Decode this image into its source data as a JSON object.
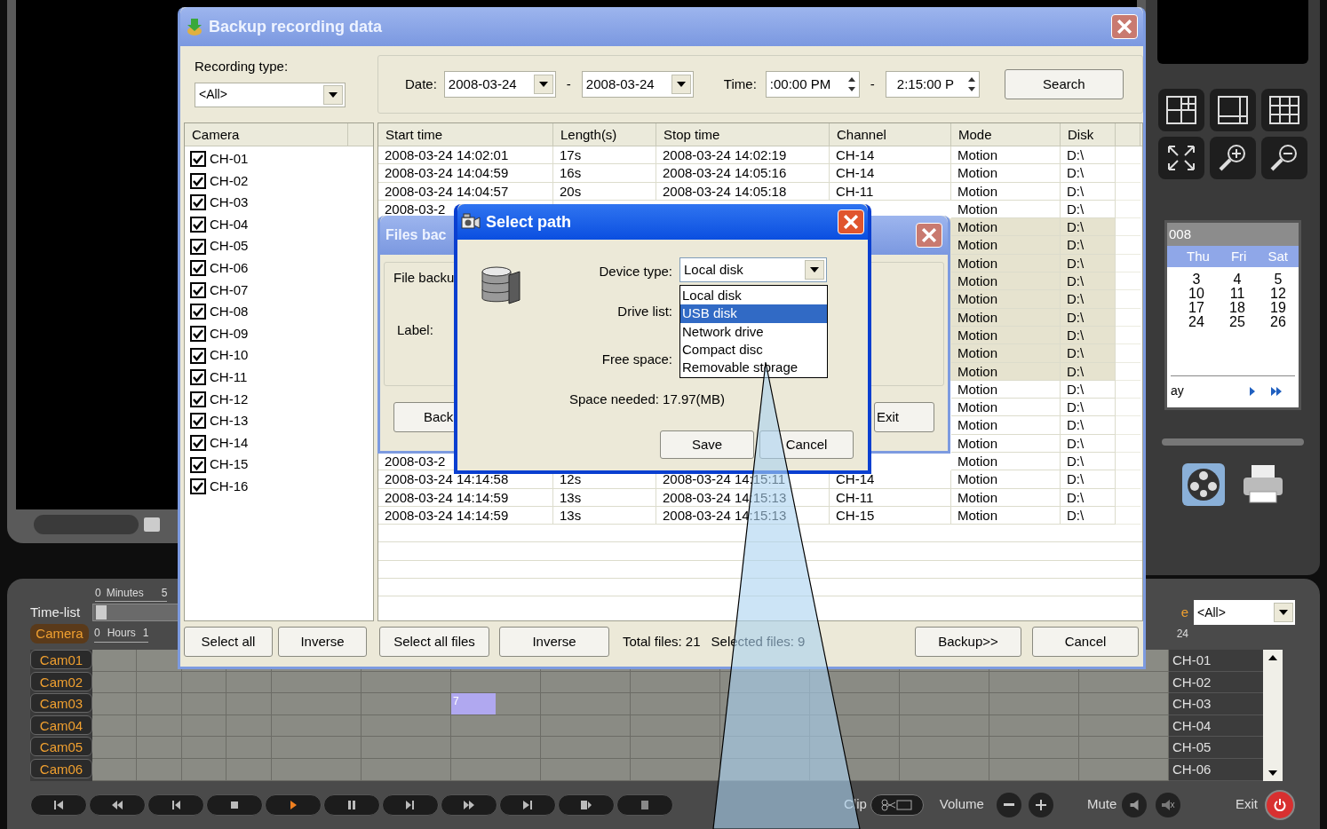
{
  "backup": {
    "title": "Backup recording data",
    "recording_type_label": "Recording type:",
    "recording_type": "<All>",
    "date_label": "Date:",
    "date_from": "2008-03-24",
    "date_sep": "-",
    "date_to": "2008-03-24",
    "time_label": "Time:",
    "time_from": ":00:00 PM",
    "time_sep": "-",
    "time_to": "2:15:00 P",
    "search": "Search",
    "camera_header": "Camera",
    "cameras": [
      {
        "label": "CH-01",
        "checked": true
      },
      {
        "label": "CH-02",
        "checked": true
      },
      {
        "label": "CH-03",
        "checked": true
      },
      {
        "label": "CH-04",
        "checked": true
      },
      {
        "label": "CH-05",
        "checked": true
      },
      {
        "label": "CH-06",
        "checked": true
      },
      {
        "label": "CH-07",
        "checked": true
      },
      {
        "label": "CH-08",
        "checked": true
      },
      {
        "label": "CH-09",
        "checked": true
      },
      {
        "label": "CH-10",
        "checked": true
      },
      {
        "label": "CH-11",
        "checked": true
      },
      {
        "label": "CH-12",
        "checked": true
      },
      {
        "label": "CH-13",
        "checked": true
      },
      {
        "label": "CH-14",
        "checked": true
      },
      {
        "label": "CH-15",
        "checked": true
      },
      {
        "label": "CH-16",
        "checked": true
      }
    ],
    "columns": [
      "Start time",
      "Length(s)",
      "Stop time",
      "Channel",
      "Mode",
      "Disk"
    ],
    "rows": [
      {
        "start": "2008-03-24 14:02:01",
        "length": "17s",
        "stop": "2008-03-24 14:02:19",
        "channel": "CH-14",
        "mode": "Motion",
        "disk": "D:\\",
        "selected": false
      },
      {
        "start": "2008-03-24 14:04:59",
        "length": "16s",
        "stop": "2008-03-24 14:05:16",
        "channel": "CH-14",
        "mode": "Motion",
        "disk": "D:\\",
        "selected": false
      },
      {
        "start": "2008-03-24 14:04:57",
        "length": "20s",
        "stop": "2008-03-24 14:05:18",
        "channel": "CH-11",
        "mode": "Motion",
        "disk": "D:\\",
        "selected": false
      },
      {
        "start": "2008-03-2",
        "mode": "Motion",
        "disk": "D:\\",
        "selected": false
      },
      {
        "mode": "Motion",
        "disk": "D:\\",
        "selected": true
      },
      {
        "mode": "Motion",
        "disk": "D:\\",
        "selected": true
      },
      {
        "mode": "Motion",
        "disk": "D:\\",
        "selected": true
      },
      {
        "mode": "Motion",
        "disk": "D:\\",
        "selected": true
      },
      {
        "mode": "Motion",
        "disk": "D:\\",
        "selected": true
      },
      {
        "mode": "Motion",
        "disk": "D:\\",
        "selected": true
      },
      {
        "mode": "Motion",
        "disk": "D:\\",
        "selected": true
      },
      {
        "mode": "Motion",
        "disk": "D:\\",
        "selected": true
      },
      {
        "mode": "Motion",
        "disk": "D:\\",
        "selected": true
      },
      {
        "mode": "Motion",
        "disk": "D:\\",
        "selected": false
      },
      {
        "mode": "Motion",
        "disk": "D:\\",
        "selected": false
      },
      {
        "mode": "Motion",
        "disk": "D:\\",
        "selected": false
      },
      {
        "mode": "Motion",
        "disk": "D:\\",
        "selected": false
      },
      {
        "start": "2008-03-2",
        "mode": "Motion",
        "disk": "D:\\",
        "selected": false
      },
      {
        "start": "2008-03-24 14:14:58",
        "length": "12s",
        "stop": "2008-03-24 14:15:11",
        "channel": "CH-14",
        "mode": "Motion",
        "disk": "D:\\",
        "selected": false
      },
      {
        "start": "2008-03-24 14:14:59",
        "length": "13s",
        "stop": "2008-03-24 14:15:13",
        "channel": "CH-11",
        "mode": "Motion",
        "disk": "D:\\",
        "selected": false
      },
      {
        "start": "2008-03-24 14:14:59",
        "length": "13s",
        "stop": "2008-03-24 14:15:13",
        "channel": "CH-15",
        "mode": "Motion",
        "disk": "D:\\",
        "selected": false
      }
    ],
    "camera_buttons": [
      "Select all",
      "Inverse"
    ],
    "file_buttons": [
      "Select all files",
      "Inverse"
    ],
    "total_files": "Total files: 21",
    "selected_files": "Selected files: 9",
    "backup_button": "Backup>>",
    "cancel_button": "Cancel"
  },
  "files_backup": {
    "title": "Files bac",
    "group_label": "File backu",
    "label_label": "Label:",
    "back_button": "Back",
    "exit_button": "Exit"
  },
  "select_path": {
    "title": "Select path",
    "device_type_label": "Device type:",
    "device_type": "Local disk",
    "drive_list_label": "Drive list:",
    "free_space_label": "Free space:",
    "space_needed": "Space needed: 17.97(MB)",
    "save_button": "Save",
    "cancel_button": "Cancel",
    "options": [
      {
        "label": "Local disk",
        "selected": false
      },
      {
        "label": "USB disk",
        "selected": true
      },
      {
        "label": "Network drive",
        "selected": false
      },
      {
        "label": "Compact disc",
        "selected": false
      },
      {
        "label": "Removable storage",
        "selected": false
      }
    ]
  },
  "player": {
    "minutes_ruler": [
      "0",
      "Minutes",
      "5"
    ],
    "hours_ruler": [
      "0",
      "Hours",
      "1"
    ],
    "time_list_label": "Time-list",
    "camera_button": "Camera",
    "cameras": [
      {
        "name": "Cam01"
      },
      {
        "name": "Cam02"
      },
      {
        "name": "Cam03",
        "marker": "7"
      },
      {
        "name": "Cam04"
      },
      {
        "name": "Cam05"
      },
      {
        "name": "Cam06"
      }
    ],
    "type_label": "e",
    "type_select": "<All>",
    "hours_end": "24",
    "channels": [
      "CH-01",
      "CH-02",
      "CH-03",
      "CH-04",
      "CH-05",
      "CH-06"
    ],
    "calendar": {
      "month": "008",
      "weekdays": [
        "Thu",
        "Fri",
        "Sat"
      ],
      "weeks": [
        [
          "3",
          "4",
          "5"
        ],
        [
          "10",
          "11",
          "12"
        ],
        [
          "17",
          "18",
          "19"
        ],
        [
          "24",
          "25",
          "26"
        ]
      ],
      "footer": "ay"
    },
    "clip_label": "Clip",
    "volume_label": "Volume",
    "mute_label": "Mute",
    "exit_label": "Exit"
  }
}
